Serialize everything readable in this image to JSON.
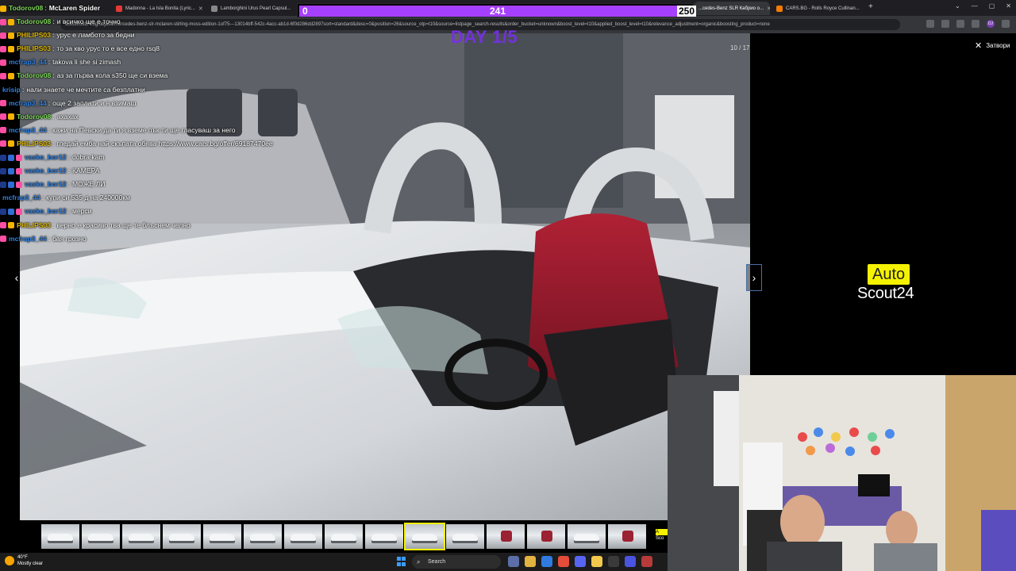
{
  "browser": {
    "tabs": [
      {
        "label": "Madonna - La Isla Bonita (Lyric...",
        "active": false
      },
      {
        "label": "Lamborghini Urus Pearl Capsul...",
        "active": false
      },
      {
        "label": "...cedes-Benz SLR Кабрио о...",
        "active": true
      },
      {
        "label": "CARS.BG - Rolls Royce Cullinan...",
        "active": false
      }
    ],
    "url": "autoscout24.bg/objava/mercedes-benz-slr-mclaren-stirling-moss-edition-1of75---13014bff-542c-4acc-ab1d-6f0d286dd2897sort=standard&desc=0&position=26&source_otp=t10&source=listpage_search-results&order_bucket=unknown&boost_level=t10&applied_boost_level=t10&relevance_adjustment=organic&boosting_product=none",
    "avatar": "DJ"
  },
  "gallery": {
    "counter": "10 / 17",
    "close_label": "Затвори",
    "prev": "‹",
    "next": "›",
    "selected_index": 9,
    "thumb_count": 15
  },
  "logo": {
    "auto": "Auto",
    "scout": "Scout24"
  },
  "thumb_logo": {
    "top": "A",
    "bottom": "Sco"
  },
  "overlay": {
    "progress_start": "0",
    "progress_current": "241",
    "progress_end": "250",
    "progress_fraction": 0.964,
    "day_text": "DAY 1/5",
    "colors": {
      "progress": "#a640ff",
      "day": "#7a2df0"
    }
  },
  "chat": [
    {
      "user": "Todorov08",
      "text": "McLaren Spider",
      "color": "#7ed957",
      "badges": [
        "crown"
      ],
      "bold_text": true
    },
    {
      "user": "Todorov08",
      "text": "и всичко ще е точно",
      "color": "#7ed957",
      "badges": [
        "pink",
        "crown"
      ]
    },
    {
      "user": "PHILIPS03",
      "text": "урус е ламбото за бедни",
      "color": "#e0b800",
      "badges": [
        "pink",
        "crown"
      ]
    },
    {
      "user": "PHILIPS03",
      "text": "то за кво урус то е все едно rsq8",
      "color": "#e0b800",
      "badges": [
        "pink",
        "crown"
      ]
    },
    {
      "user": "mcfrap3_44",
      "text": "takova li she si zimash",
      "color": "#2f7fe0",
      "badges": [
        "pink"
      ]
    },
    {
      "user": "Todorov08",
      "text": "аз за първа кола s350 ще си взема",
      "color": "#7ed957",
      "badges": [
        "pink",
        "crown"
      ]
    },
    {
      "user": "krisip",
      "text": "нали знаете че мечтите са безплатни",
      "color": "#2f7fe0",
      "badges": []
    },
    {
      "user": "mcfrap3_44",
      "text": "още 2 заплати и я взимаш",
      "color": "#2f7fe0",
      "badges": [
        "pink"
      ]
    },
    {
      "user": "Todorov08",
      "text": "ахахах",
      "color": "#7ed957",
      "badges": [
        "pink",
        "crown"
      ]
    },
    {
      "user": "mcfrap3_44",
      "text": "кажи на Певски да ти я вземе пък ти ще гласуваш за него",
      "color": "#2f7fe0",
      "badges": [
        "pink"
      ]
    },
    {
      "user": "PHILIPS03",
      "text": "гледай емба най скъпата обява https://www.cars.bg/offer/69187470ee",
      "color": "#e0b800",
      "badges": [
        "pink",
        "crown"
      ]
    },
    {
      "user": "vasko_bor12",
      "text": "dobra kam",
      "color": "#2f7fe0",
      "badges": [
        "play",
        "blue",
        "pink"
      ]
    },
    {
      "user": "vasko_bor12",
      "text": "КАМЕРА",
      "color": "#2f7fe0",
      "badges": [
        "play",
        "blue",
        "pink"
      ]
    },
    {
      "user": "vasko_bor12",
      "text": "МОЖЕ ЛИ",
      "color": "#2f7fe0",
      "badges": [
        "play",
        "blue",
        "pink"
      ]
    },
    {
      "user": "mcfrap3_44",
      "text": "купи си 535 д на 240000км",
      "color": "#2f7fe0",
      "badges": []
    },
    {
      "user": "vasko_bor12",
      "text": "мерси",
      "color": "#2f7fe0",
      "badges": [
        "play",
        "blue",
        "pink"
      ]
    },
    {
      "user": "PHILIPS03",
      "text": "верно е красиво тва ще те блъснем челно",
      "color": "#e0b800",
      "badges": [
        "pink",
        "crown"
      ]
    },
    {
      "user": "mcfrap3_44",
      "text": "бая грозно",
      "color": "#2f7fe0",
      "badges": [
        "pink"
      ]
    }
  ],
  "taskbar": {
    "temp": "40°F",
    "weather": "Mostly clear",
    "search_placeholder": "Search"
  }
}
